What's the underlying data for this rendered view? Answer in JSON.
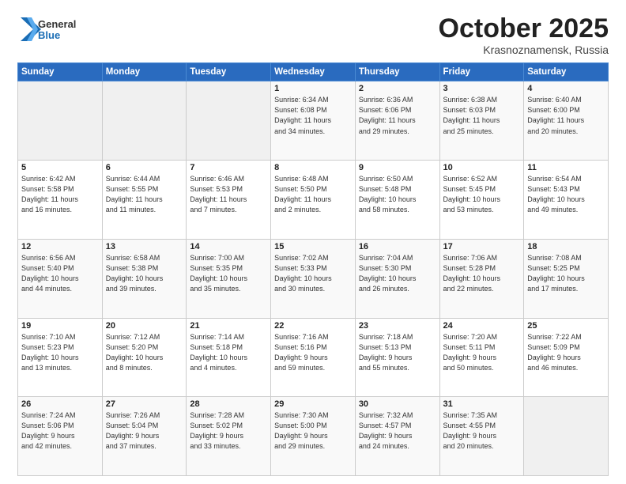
{
  "header": {
    "logo_general": "General",
    "logo_blue": "Blue",
    "month_title": "October 2025",
    "location": "Krasnoznamensk, Russia"
  },
  "days_of_week": [
    "Sunday",
    "Monday",
    "Tuesday",
    "Wednesday",
    "Thursday",
    "Friday",
    "Saturday"
  ],
  "weeks": [
    [
      {
        "day": "",
        "info": ""
      },
      {
        "day": "",
        "info": ""
      },
      {
        "day": "",
        "info": ""
      },
      {
        "day": "1",
        "info": "Sunrise: 6:34 AM\nSunset: 6:08 PM\nDaylight: 11 hours\nand 34 minutes."
      },
      {
        "day": "2",
        "info": "Sunrise: 6:36 AM\nSunset: 6:06 PM\nDaylight: 11 hours\nand 29 minutes."
      },
      {
        "day": "3",
        "info": "Sunrise: 6:38 AM\nSunset: 6:03 PM\nDaylight: 11 hours\nand 25 minutes."
      },
      {
        "day": "4",
        "info": "Sunrise: 6:40 AM\nSunset: 6:00 PM\nDaylight: 11 hours\nand 20 minutes."
      }
    ],
    [
      {
        "day": "5",
        "info": "Sunrise: 6:42 AM\nSunset: 5:58 PM\nDaylight: 11 hours\nand 16 minutes."
      },
      {
        "day": "6",
        "info": "Sunrise: 6:44 AM\nSunset: 5:55 PM\nDaylight: 11 hours\nand 11 minutes."
      },
      {
        "day": "7",
        "info": "Sunrise: 6:46 AM\nSunset: 5:53 PM\nDaylight: 11 hours\nand 7 minutes."
      },
      {
        "day": "8",
        "info": "Sunrise: 6:48 AM\nSunset: 5:50 PM\nDaylight: 11 hours\nand 2 minutes."
      },
      {
        "day": "9",
        "info": "Sunrise: 6:50 AM\nSunset: 5:48 PM\nDaylight: 10 hours\nand 58 minutes."
      },
      {
        "day": "10",
        "info": "Sunrise: 6:52 AM\nSunset: 5:45 PM\nDaylight: 10 hours\nand 53 minutes."
      },
      {
        "day": "11",
        "info": "Sunrise: 6:54 AM\nSunset: 5:43 PM\nDaylight: 10 hours\nand 49 minutes."
      }
    ],
    [
      {
        "day": "12",
        "info": "Sunrise: 6:56 AM\nSunset: 5:40 PM\nDaylight: 10 hours\nand 44 minutes."
      },
      {
        "day": "13",
        "info": "Sunrise: 6:58 AM\nSunset: 5:38 PM\nDaylight: 10 hours\nand 39 minutes."
      },
      {
        "day": "14",
        "info": "Sunrise: 7:00 AM\nSunset: 5:35 PM\nDaylight: 10 hours\nand 35 minutes."
      },
      {
        "day": "15",
        "info": "Sunrise: 7:02 AM\nSunset: 5:33 PM\nDaylight: 10 hours\nand 30 minutes."
      },
      {
        "day": "16",
        "info": "Sunrise: 7:04 AM\nSunset: 5:30 PM\nDaylight: 10 hours\nand 26 minutes."
      },
      {
        "day": "17",
        "info": "Sunrise: 7:06 AM\nSunset: 5:28 PM\nDaylight: 10 hours\nand 22 minutes."
      },
      {
        "day": "18",
        "info": "Sunrise: 7:08 AM\nSunset: 5:25 PM\nDaylight: 10 hours\nand 17 minutes."
      }
    ],
    [
      {
        "day": "19",
        "info": "Sunrise: 7:10 AM\nSunset: 5:23 PM\nDaylight: 10 hours\nand 13 minutes."
      },
      {
        "day": "20",
        "info": "Sunrise: 7:12 AM\nSunset: 5:20 PM\nDaylight: 10 hours\nand 8 minutes."
      },
      {
        "day": "21",
        "info": "Sunrise: 7:14 AM\nSunset: 5:18 PM\nDaylight: 10 hours\nand 4 minutes."
      },
      {
        "day": "22",
        "info": "Sunrise: 7:16 AM\nSunset: 5:16 PM\nDaylight: 9 hours\nand 59 minutes."
      },
      {
        "day": "23",
        "info": "Sunrise: 7:18 AM\nSunset: 5:13 PM\nDaylight: 9 hours\nand 55 minutes."
      },
      {
        "day": "24",
        "info": "Sunrise: 7:20 AM\nSunset: 5:11 PM\nDaylight: 9 hours\nand 50 minutes."
      },
      {
        "day": "25",
        "info": "Sunrise: 7:22 AM\nSunset: 5:09 PM\nDaylight: 9 hours\nand 46 minutes."
      }
    ],
    [
      {
        "day": "26",
        "info": "Sunrise: 7:24 AM\nSunset: 5:06 PM\nDaylight: 9 hours\nand 42 minutes."
      },
      {
        "day": "27",
        "info": "Sunrise: 7:26 AM\nSunset: 5:04 PM\nDaylight: 9 hours\nand 37 minutes."
      },
      {
        "day": "28",
        "info": "Sunrise: 7:28 AM\nSunset: 5:02 PM\nDaylight: 9 hours\nand 33 minutes."
      },
      {
        "day": "29",
        "info": "Sunrise: 7:30 AM\nSunset: 5:00 PM\nDaylight: 9 hours\nand 29 minutes."
      },
      {
        "day": "30",
        "info": "Sunrise: 7:32 AM\nSunset: 4:57 PM\nDaylight: 9 hours\nand 24 minutes."
      },
      {
        "day": "31",
        "info": "Sunrise: 7:35 AM\nSunset: 4:55 PM\nDaylight: 9 hours\nand 20 minutes."
      },
      {
        "day": "",
        "info": ""
      }
    ]
  ]
}
